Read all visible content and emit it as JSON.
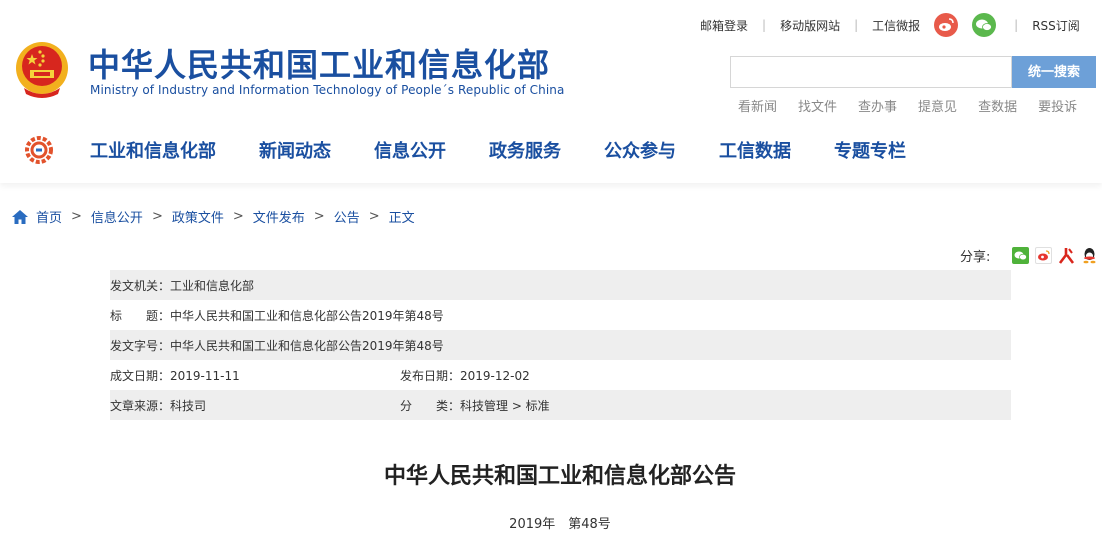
{
  "header": {
    "title_cn": "中华人民共和国工业和信息化部",
    "title_en": "Ministry of Industry and Information Technology of People´s Republic of China",
    "emblem_icon": "national-emblem-icon",
    "top_links": {
      "mail_login": "邮箱登录",
      "mobile_site": "移动版网站",
      "weibo_label": "工信微报",
      "rss": "RSS订阅"
    },
    "search": {
      "placeholder": "",
      "button": "统一搜索"
    },
    "quick_links": [
      "看新闻",
      "找文件",
      "查办事",
      "提意见",
      "查数据",
      "要投诉"
    ]
  },
  "nav": {
    "logo_icon": "gear-logo-icon",
    "items": [
      "工业和信息化部",
      "新闻动态",
      "信息公开",
      "政务服务",
      "公众参与",
      "工信数据",
      "专题专栏"
    ]
  },
  "breadcrumb": {
    "items": [
      "首页",
      "信息公开",
      "政策文件",
      "文件发布",
      "公告"
    ],
    "current": "正文",
    "separator": ">"
  },
  "share": {
    "label": "分享:",
    "icons": [
      "wechat-share-icon",
      "weibo-share-icon",
      "renren-share-icon",
      "qq-share-icon"
    ]
  },
  "info": {
    "issuer": "发文机关：工业和信息化部",
    "title": "标　　题：中华人民共和国工业和信息化部公告2019年第48号",
    "doc_no": "发文字号：中华人民共和国工业和信息化部公告2019年第48号",
    "created": "成文日期：2019-11-11",
    "published": "发布日期：2019-12-02",
    "source": "文章来源：科技司",
    "category": "分　　类：科技管理 > 标准"
  },
  "document": {
    "title": "中华人民共和国工业和信息化部公告",
    "number": "2019年　第48号"
  },
  "colors": {
    "brand_blue": "#1a4fa0",
    "search_button": "#6da0d8",
    "table_shade": "#eeeeee",
    "weibo_red": "#e85a4a",
    "wechat_green": "#5bb84d"
  }
}
